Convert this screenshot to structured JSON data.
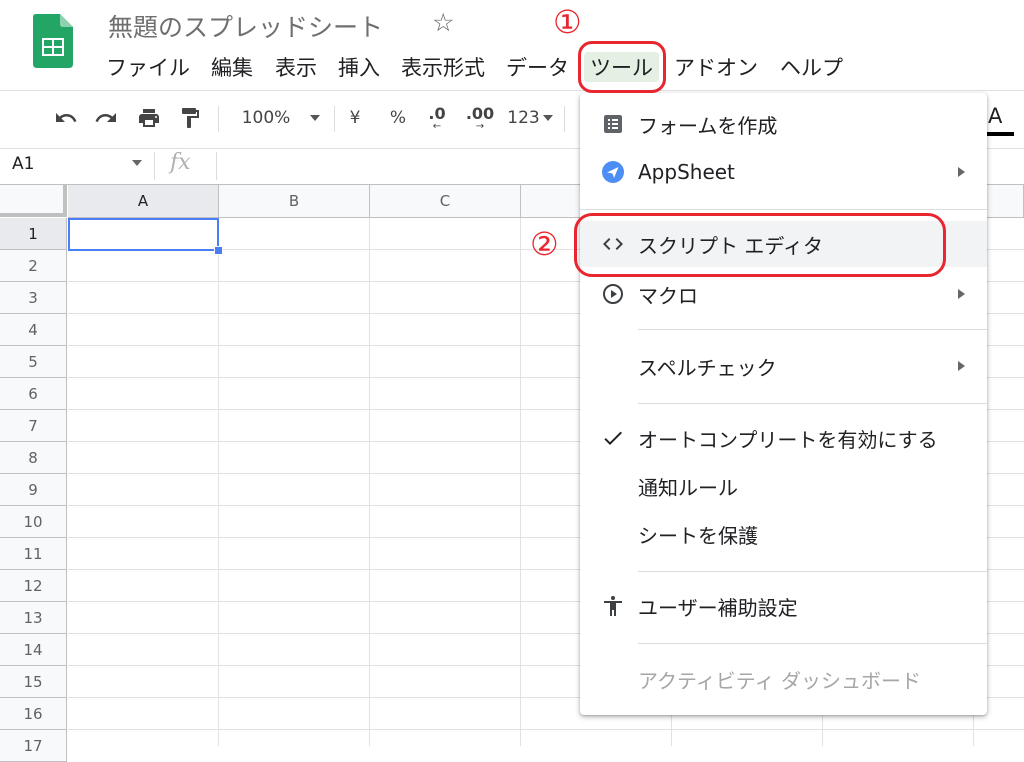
{
  "header": {
    "doc_title": "無題のスプレッドシート",
    "star_glyph": "☆"
  },
  "menu": {
    "items": [
      {
        "label": "ファイル"
      },
      {
        "label": "編集"
      },
      {
        "label": "表示"
      },
      {
        "label": "挿入"
      },
      {
        "label": "表示形式"
      },
      {
        "label": "データ"
      },
      {
        "label": "ツール",
        "active": true
      },
      {
        "label": "アドオン"
      },
      {
        "label": "ヘルプ"
      }
    ]
  },
  "toolbar": {
    "zoom": "100%",
    "currency": "¥",
    "percent": "%",
    "decrease_decimal": ".0",
    "increase_decimal": ".00",
    "number_format": "123",
    "text_color_glyph": "A"
  },
  "formula_bar": {
    "name_box": "A1",
    "fx_label": "fx",
    "value": ""
  },
  "grid": {
    "columns": [
      "A",
      "B",
      "C"
    ],
    "rows": [
      "1",
      "2",
      "3",
      "4",
      "5",
      "6",
      "7",
      "8",
      "9",
      "10",
      "11",
      "12",
      "13",
      "14",
      "15",
      "16",
      "17"
    ],
    "active_cell": "A1"
  },
  "tools_menu": {
    "items": [
      {
        "label": "フォームを作成",
        "icon": "form-icon"
      },
      {
        "label": "AppSheet",
        "icon": "appsheet-icon",
        "submenu": true
      },
      {
        "label": "スクリプト エディタ",
        "icon": "code-icon"
      },
      {
        "label": "マクロ",
        "icon": "play-circle-icon",
        "submenu": true
      },
      {
        "label": "スペルチェック",
        "submenu": true
      },
      {
        "label": "オートコンプリートを有効にする",
        "icon": "check-icon"
      },
      {
        "label": "通知ルール"
      },
      {
        "label": "シートを保護"
      },
      {
        "label": "ユーザー補助設定",
        "icon": "accessibility-icon"
      },
      {
        "label": "アクティビティ ダッシュボード",
        "disabled": true
      }
    ]
  },
  "annotations": {
    "step1": "①",
    "step2": "②",
    "color": "#e8262f"
  }
}
